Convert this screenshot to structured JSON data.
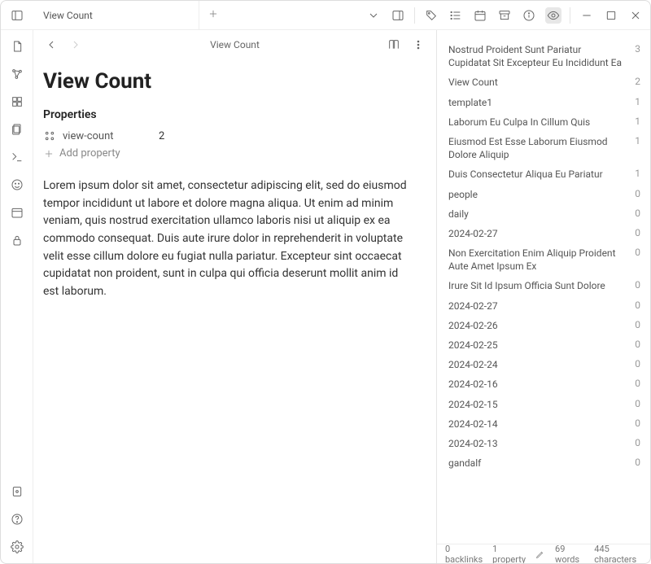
{
  "tab": {
    "title": "View Count"
  },
  "breadcrumb": {
    "label": "View Count"
  },
  "page": {
    "title": "View Count",
    "properties_heading": "Properties",
    "prop_key": "view-count",
    "prop_val": "2",
    "add_property_label": "Add property",
    "body": "Lorem ipsum dolor sit amet, consectetur adipiscing elit, sed do eiusmod tempor incididunt ut labore et dolore magna aliqua. Ut enim ad minim veniam, quis nostrud exercitation ullamco laboris nisi ut aliquip ex ea commodo consequat. Duis aute irure dolor in reprehenderit in voluptate velit esse cillum dolore eu fugiat nulla pariatur. Excepteur sint occaecat cupidatat non proident, sunt in culpa qui officia deserunt mollit anim id est laborum."
  },
  "viewlist": [
    {
      "name": "Nostrud Proident Sunt Pariatur Cupidatat Sit Excepteur Eu Incididunt Ea",
      "count": "3"
    },
    {
      "name": "View Count",
      "count": "2"
    },
    {
      "name": "template1",
      "count": "1"
    },
    {
      "name": "Laborum Eu Culpa In Cillum Quis",
      "count": "1"
    },
    {
      "name": "Eiusmod Est Esse Laborum Eiusmod Dolore Aliquip",
      "count": "1"
    },
    {
      "name": "Duis Consectetur Aliqua Eu Pariatur",
      "count": "1"
    },
    {
      "name": "people",
      "count": "0"
    },
    {
      "name": "daily",
      "count": "0"
    },
    {
      "name": "2024-02-27",
      "count": "0"
    },
    {
      "name": "Non Exercitation Enim Aliquip Proident Aute Amet Ipsum Ex",
      "count": "0"
    },
    {
      "name": "Irure Sit Id Ipsum Officia Sunt Dolore",
      "count": "0"
    },
    {
      "name": "2024-02-27",
      "count": "0"
    },
    {
      "name": "2024-02-26",
      "count": "0"
    },
    {
      "name": "2024-02-25",
      "count": "0"
    },
    {
      "name": "2024-02-24",
      "count": "0"
    },
    {
      "name": "2024-02-16",
      "count": "0"
    },
    {
      "name": "2024-02-15",
      "count": "0"
    },
    {
      "name": "2024-02-14",
      "count": "0"
    },
    {
      "name": "2024-02-13",
      "count": "0"
    },
    {
      "name": "gandalf",
      "count": "0"
    }
  ],
  "status": {
    "backlinks": "0 backlinks",
    "properties": "1 property",
    "words": "69 words",
    "chars": "445 characters"
  }
}
